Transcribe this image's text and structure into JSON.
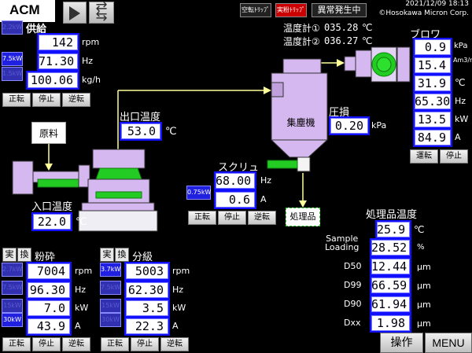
{
  "header": {
    "app": "ACM",
    "datetime": "2021/12/09  18:13",
    "copyright": "©Hosokawa Micron Corp.",
    "alarms": [
      "空転ﾄﾘｯﾌﾟ",
      "実粉ﾄﾘｯﾌﾟ",
      "異常発生中"
    ]
  },
  "feed": {
    "title": "供給",
    "kw": [
      "2.2kW",
      "7.5kW",
      "1.5kW"
    ],
    "values": [
      "142",
      "71.30",
      "100.06"
    ],
    "units": [
      "rpm",
      "Hz",
      "kg/h"
    ],
    "buttons": [
      "正転",
      "停止",
      "逆転"
    ]
  },
  "outlet_temp": {
    "label": "出口温度",
    "value": "53.0",
    "unit": "℃"
  },
  "raw_material": "原料",
  "inlet_temp": {
    "label": "入口温度",
    "value": "22.0",
    "unit": "℃"
  },
  "thermo": {
    "t1_label": "温度計①",
    "t1_value": "035.28",
    "t1_unit": "℃",
    "t2_label": "温度計②",
    "t2_value": "036.27",
    "t2_unit": "℃"
  },
  "blower": {
    "title": "ブロワ",
    "values": [
      "0.9",
      "15.4",
      "31.9",
      "65.30",
      "13.5",
      "84.9"
    ],
    "units": [
      "kPa",
      "Am3/min",
      "℃",
      "Hz",
      "kW",
      "A"
    ],
    "buttons": [
      "運転",
      "停止"
    ]
  },
  "collector": {
    "label": "集塵機",
    "pressure_label": "圧損",
    "pressure_value": "0.20",
    "pressure_unit": "kPa"
  },
  "screw": {
    "title": "スクリュ",
    "kw": "0.75kW",
    "values": [
      "68.00",
      "0.6"
    ],
    "units": [
      "Hz",
      "A"
    ],
    "buttons": [
      "正転",
      "停止",
      "逆転"
    ]
  },
  "product": {
    "label": "処理品"
  },
  "product_temp": {
    "label": "処理品温度",
    "value": "25.9",
    "unit": "℃"
  },
  "results": {
    "rows": [
      {
        "label": "Sample\nLoading",
        "value": "28.52",
        "unit": "%"
      },
      {
        "label": "D50",
        "value": "12.44",
        "unit": "μm"
      },
      {
        "label": "D99",
        "value": "66.59",
        "unit": "μm"
      },
      {
        "label": "D90",
        "value": "61.94",
        "unit": "μm"
      },
      {
        "label": "Dxx",
        "value": "1.98",
        "unit": "μm"
      }
    ]
  },
  "mill": {
    "mode": [
      "実",
      "換"
    ],
    "title": "粉砕",
    "kw": [
      "2.7kW",
      "7.5kW",
      "15kW",
      "30kW"
    ],
    "values": [
      "7004",
      "96.30",
      "7.0",
      "43.9"
    ],
    "units": [
      "rpm",
      "Hz",
      "kW",
      "A"
    ],
    "buttons": [
      "正転",
      "停止",
      "逆転"
    ]
  },
  "classifier": {
    "mode": [
      "実",
      "換"
    ],
    "title": "分級",
    "kw": [
      "3.7kW",
      "7.5kW",
      "15kW",
      "30kW"
    ],
    "values": [
      "5003",
      "62.30",
      "3.5",
      "22.3"
    ],
    "units": [
      "rpm",
      "Hz",
      "kW",
      "A"
    ],
    "buttons": [
      "正転",
      "停止",
      "逆転"
    ]
  },
  "footer": {
    "operate": "操作",
    "menu": "MENU"
  },
  "colors": {
    "accent": "#1010ff",
    "machine": "#d6b8f0",
    "pipe": "#ffff99",
    "green": "#22cc22",
    "alarm": "#cc0000"
  }
}
